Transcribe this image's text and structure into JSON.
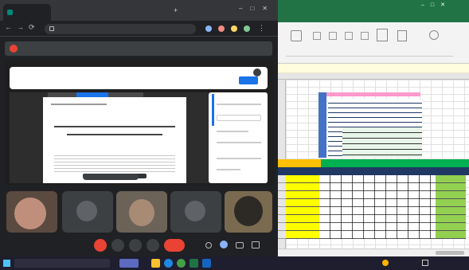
{
  "browser": {
    "tabs": [
      {
        "label": "",
        "active": true
      },
      {
        "label": "",
        "active": false
      },
      {
        "label": "",
        "active": false
      }
    ],
    "address": "",
    "banner_text": "",
    "shared_window_title": "",
    "shared_window_field": "",
    "doc_title_1": "",
    "doc_title_2": "",
    "side_panel_title": ""
  },
  "meet": {
    "participants": [
      {
        "name": ""
      },
      {
        "name": ""
      },
      {
        "name": ""
      },
      {
        "name": ""
      },
      {
        "name": ""
      }
    ],
    "meeting_code": ""
  },
  "excel": {
    "title": "",
    "ribbon_tabs": [
      "",
      "",
      "",
      "",
      "",
      "",
      "",
      ""
    ],
    "sheet_tabs": [
      "",
      "",
      ""
    ],
    "header_band_label": "",
    "colors": {
      "brand": "#217346",
      "yellow": "#ffff00",
      "green": "#92d050",
      "pink": "#ff99cc",
      "blue": "#4472c4",
      "navy": "#1f3864"
    }
  },
  "taskbar": {
    "search_placeholder": "",
    "clock": ""
  }
}
